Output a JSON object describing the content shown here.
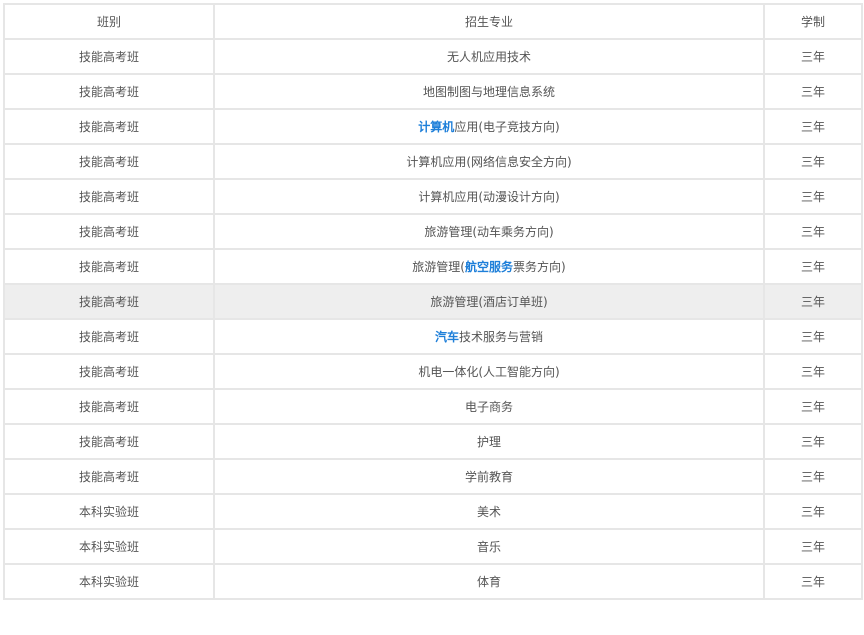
{
  "headers": [
    "班别",
    "招生专业",
    "学制"
  ],
  "rows": [
    {
      "class": "技能高考班",
      "major": [
        {
          "t": "无人机应用技术"
        }
      ],
      "duration": "三年"
    },
    {
      "class": "技能高考班",
      "major": [
        {
          "t": "地图制图与地理信息系统"
        }
      ],
      "duration": "三年"
    },
    {
      "class": "技能高考班",
      "major": [
        {
          "t": "计算机",
          "link": true
        },
        {
          "t": "应用(电子竞技方向)"
        }
      ],
      "duration": "三年"
    },
    {
      "class": "技能高考班",
      "major": [
        {
          "t": "计算机应用(网络信息安全方向)"
        }
      ],
      "duration": "三年"
    },
    {
      "class": "技能高考班",
      "major": [
        {
          "t": "计算机应用(动漫设计方向)"
        }
      ],
      "duration": "三年"
    },
    {
      "class": "技能高考班",
      "major": [
        {
          "t": "旅游管理(动车乘务方向)"
        }
      ],
      "duration": "三年"
    },
    {
      "class": "技能高考班",
      "major": [
        {
          "t": "旅游管理("
        },
        {
          "t": "航空服务",
          "link": true
        },
        {
          "t": "票务方向)"
        }
      ],
      "duration": "三年"
    },
    {
      "class": "技能高考班",
      "major": [
        {
          "t": "旅游管理(酒店订单班)"
        }
      ],
      "duration": "三年",
      "highlight": true
    },
    {
      "class": "技能高考班",
      "major": [
        {
          "t": "汽车",
          "link": true
        },
        {
          "t": "技术服务与营销"
        }
      ],
      "duration": "三年"
    },
    {
      "class": "技能高考班",
      "major": [
        {
          "t": "机电一体化(人工智能方向)"
        }
      ],
      "duration": "三年"
    },
    {
      "class": "技能高考班",
      "major": [
        {
          "t": "电子商务"
        }
      ],
      "duration": "三年"
    },
    {
      "class": "技能高考班",
      "major": [
        {
          "t": "护理"
        }
      ],
      "duration": "三年"
    },
    {
      "class": "技能高考班",
      "major": [
        {
          "t": "学前教育"
        }
      ],
      "duration": "三年"
    },
    {
      "class": "本科实验班",
      "major": [
        {
          "t": "美术"
        }
      ],
      "duration": "三年"
    },
    {
      "class": "本科实验班",
      "major": [
        {
          "t": "音乐"
        }
      ],
      "duration": "三年"
    },
    {
      "class": "本科实验班",
      "major": [
        {
          "t": "体育"
        }
      ],
      "duration": "三年"
    }
  ],
  "colors": {
    "link": "#1e7fd9",
    "border": "#e6e6e6",
    "text": "#555555",
    "highlight_row": "#eeeeee"
  }
}
